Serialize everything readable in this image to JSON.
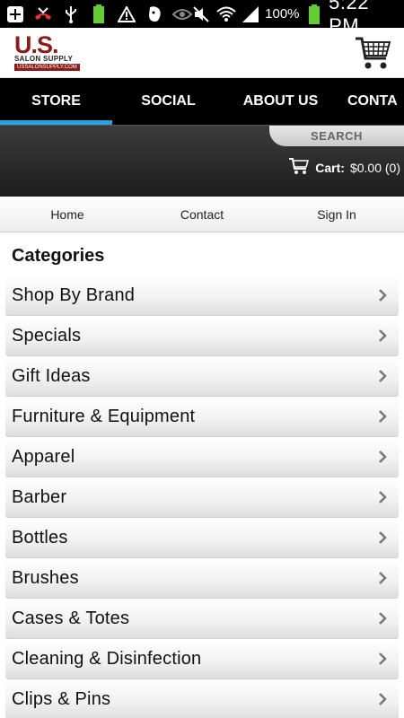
{
  "status_bar": {
    "icons_left": [
      "add-icon",
      "missed-call-icon",
      "usb-icon",
      "battery-small-icon",
      "warning-icon",
      "evernote-icon",
      "eye-icon"
    ],
    "icons_right": [
      "mute-icon",
      "wifi-icon",
      "signal-icon",
      "battery-icon"
    ],
    "battery_pct": "100%",
    "time": "5:22 PM"
  },
  "header": {
    "logo_main": "U.S.",
    "logo_sub": "SALON SUPPLY",
    "logo_url": "USSALONSUPPLY.COM",
    "cart_icon": "shopping-cart-icon"
  },
  "nav": {
    "tabs": [
      {
        "label": "STORE"
      },
      {
        "label": "SOCIAL"
      },
      {
        "label": "ABOUT US"
      },
      {
        "label": "CONTA"
      }
    ]
  },
  "band": {
    "search_label": "SEARCH",
    "cart_label": "Cart:",
    "cart_amount": "$0.00 (0)"
  },
  "subnav": {
    "items": [
      {
        "label": "Home"
      },
      {
        "label": "Contact"
      },
      {
        "label": "Sign In"
      }
    ]
  },
  "categories": {
    "title": "Categories",
    "items": [
      {
        "label": "Shop By Brand"
      },
      {
        "label": "Specials"
      },
      {
        "label": "Gift Ideas"
      },
      {
        "label": "Furniture & Equipment"
      },
      {
        "label": "Apparel"
      },
      {
        "label": "Barber"
      },
      {
        "label": "Bottles"
      },
      {
        "label": "Brushes"
      },
      {
        "label": "Cases & Totes"
      },
      {
        "label": "Cleaning & Disinfection"
      },
      {
        "label": "Clips & Pins"
      }
    ]
  },
  "colors": {
    "brand": "#8b1c1c",
    "nav_active": "#29a3e0"
  }
}
